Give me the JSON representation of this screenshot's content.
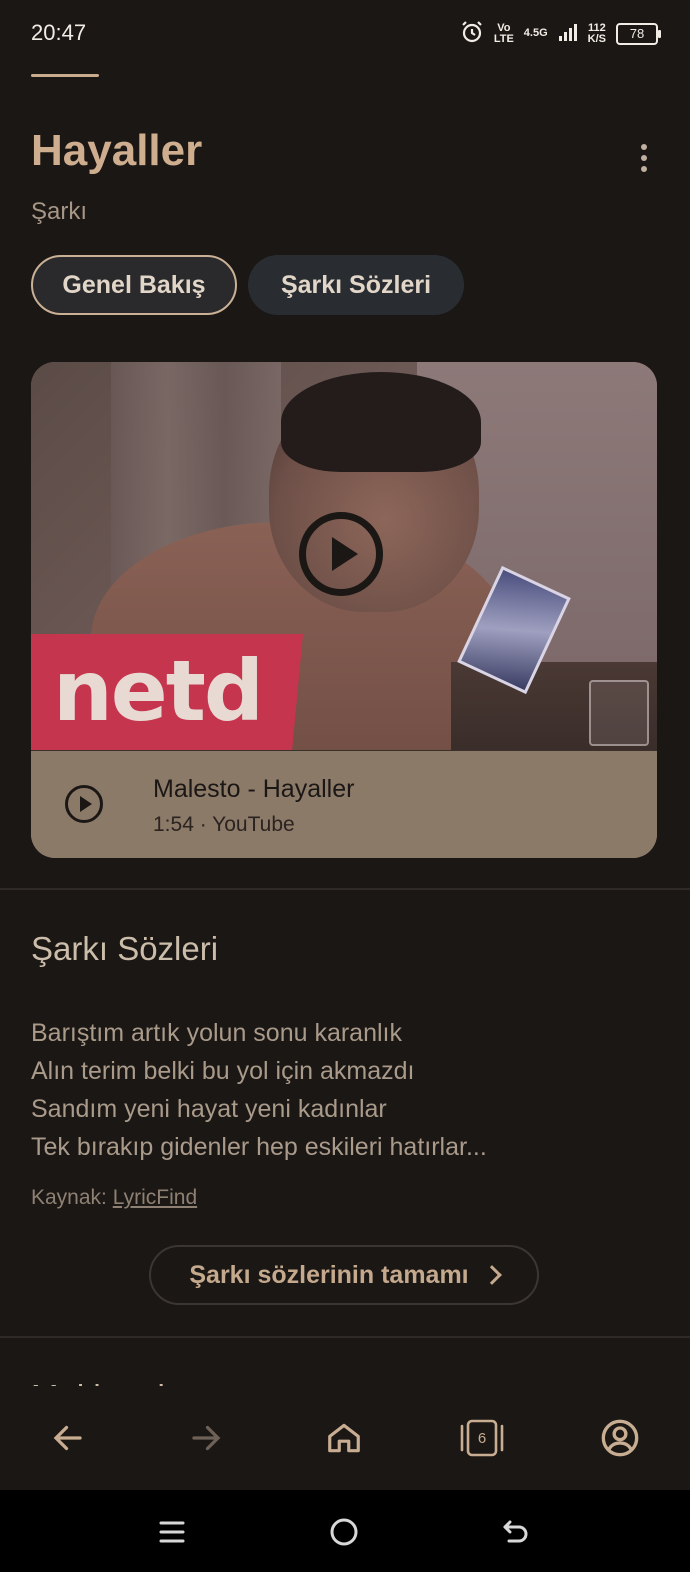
{
  "status_bar": {
    "time": "20:47",
    "volte_top": "Vo",
    "volte_bottom": "LTE",
    "network": "4.5G",
    "speed_value": "112",
    "speed_unit": "K/S",
    "battery": "78",
    "icons": [
      "alarm-icon",
      "signal-icon",
      "battery-icon"
    ]
  },
  "header": {
    "title": "Hayaller",
    "subtitle": "Şarkı",
    "more_icon": "more-vert-icon"
  },
  "tabs": [
    {
      "label": "Genel Bakış",
      "selected": true
    },
    {
      "label": "Şarkı Sözleri",
      "selected": false
    }
  ],
  "video": {
    "thumbnail_logo_text": "netd",
    "title": "Malesto - Hayaller",
    "meta": "1:54 · YouTube",
    "play_icon": "play-circle-icon"
  },
  "lyrics_section": {
    "heading": "Şarkı Sözleri",
    "lines": [
      "Barıştım artık yolun sonu karanlık",
      "Alın terim belki bu yol için akmazdı",
      "Sandım yeni hayat yeni kadınlar",
      "Tek bırakıp gidenler hep eskileri hatırlar..."
    ],
    "source_prefix": "Kaynak:",
    "source_link": "LyricFind",
    "full_lyrics_button": "Şarkı sözlerinin tamamı"
  },
  "next_section": {
    "heading": "Multimedya"
  },
  "bottom_nav": {
    "tab_count": "6",
    "icons": [
      "back-arrow-icon",
      "forward-arrow-icon",
      "home-icon",
      "tabs-icon",
      "account-icon"
    ]
  },
  "system_nav": {
    "icons": [
      "menu-icon",
      "home-circle-icon",
      "back-icon"
    ]
  },
  "colors": {
    "background": "#1b1715",
    "accent": "#cfae8f",
    "card": "#8c7a69",
    "badge_red": "#c5354e"
  }
}
